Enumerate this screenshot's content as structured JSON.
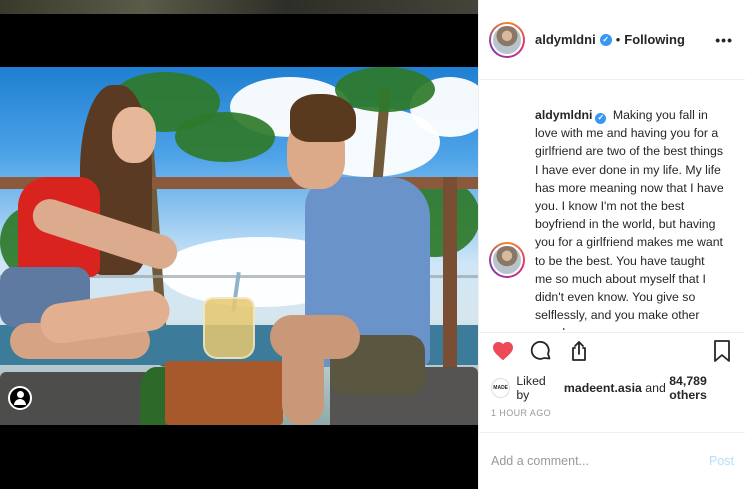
{
  "post": {
    "username": "aldymldni",
    "follow_status": "Following",
    "more_label": "•••",
    "caption_user": "aldymldni",
    "caption_text": "Making you fall in love with me and having you for a girlfriend are two of the best things I have ever done in my life. My life has more meaning now that I have you. I know I'm not the best boyfriend in the world, but having you for a girlfriend makes me want to be the best. You have taught me so much about myself that I didn't even know. You give so selflessly, and you make other people",
    "liked_by_prefix": "Liked by",
    "liked_by_user": "madeent.asia",
    "liked_by_and": "and",
    "like_count": "84,789 others",
    "timestamp": "1 HOUR AGO",
    "liker_avatar_text": "MADE",
    "comment_placeholder": "Add a comment...",
    "post_button": "Post"
  },
  "icons": {
    "like": "heart-icon",
    "comment": "comment-icon",
    "share": "share-icon",
    "save": "bookmark-icon",
    "account": "user-icon",
    "verified": "verified-badge-icon"
  },
  "colors": {
    "like_red": "#ed4956",
    "verified_blue": "#3897f0",
    "post_button_disabled": "#b2dffc"
  }
}
